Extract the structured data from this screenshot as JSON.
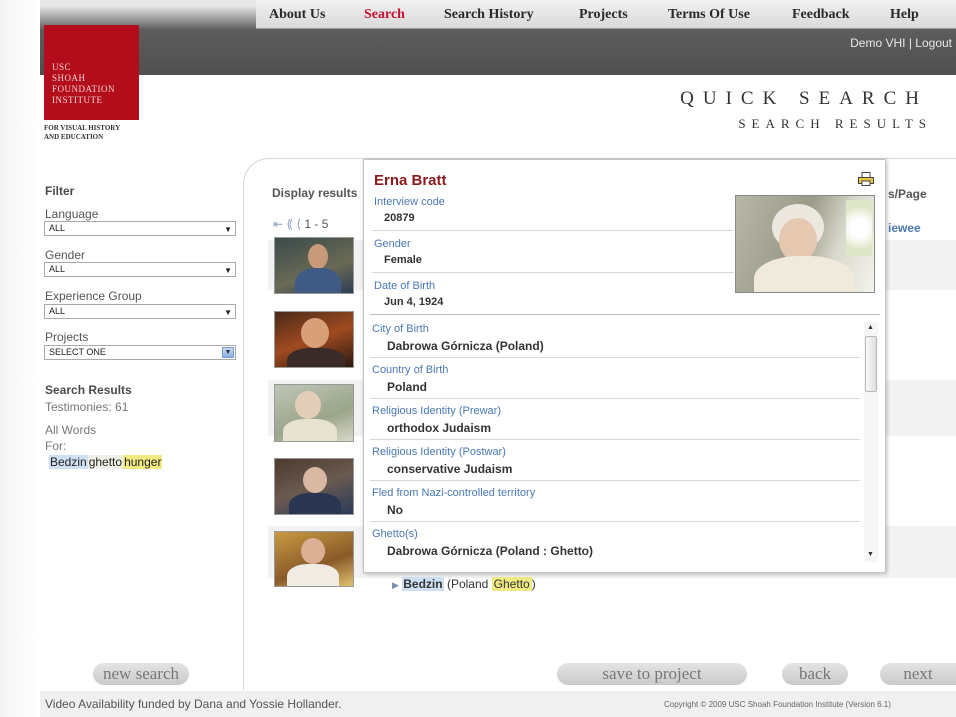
{
  "nav": {
    "items": [
      "About Us",
      "Search",
      "Search History",
      "Projects",
      "Terms Of Use",
      "Feedback",
      "Help"
    ],
    "active": "Search"
  },
  "account": {
    "demo": "Demo VHI",
    "separator": "|",
    "logout": "Logout"
  },
  "logo": {
    "lines": [
      "USC",
      "SHOAH",
      "FOUNDATION",
      "INSTITUTE"
    ],
    "subtitle_lines": [
      "FOR VISUAL HISTORY",
      "AND EDUCATION"
    ]
  },
  "page": {
    "title": "QUICK SEARCH",
    "subtitle": "SEARCH RESULTS"
  },
  "filter": {
    "heading": "Filter",
    "language_label": "Language",
    "language_value": "ALL",
    "gender_label": "Gender",
    "gender_value": "ALL",
    "experience_label": "Experience Group",
    "experience_value": "ALL",
    "projects_label": "Projects",
    "projects_value": "SELECT ONE"
  },
  "results_summary": {
    "heading": "Search Results",
    "testimonies": "Testimonies: 61",
    "all_words": "All Words",
    "for": "For:",
    "terms": [
      "Bedzin",
      "ghetto",
      "hunger"
    ]
  },
  "results": {
    "display_label": "Display results",
    "pager_icons": "⇤ ⟪ ⟨",
    "range": "1 - 5",
    "per_page": "s/Page",
    "col_interviewee": "iewee",
    "bedzin_entry": {
      "name": "Bedzin",
      "paren_open": "(Poland",
      "ghetto": "Ghetto",
      "paren_close": ")"
    }
  },
  "popup": {
    "name": "Erna Bratt",
    "fields": [
      {
        "label": "Interview code",
        "value": "20879"
      },
      {
        "label": "Gender",
        "value": "Female"
      },
      {
        "label": "Date of Birth",
        "value": "Jun 4, 1924"
      }
    ],
    "scroll_fields": [
      {
        "label": "City of Birth",
        "value": "Dabrowa Górnicza (Poland)"
      },
      {
        "label": "Country of Birth",
        "value": "Poland"
      },
      {
        "label": "Religious Identity (Prewar)",
        "value": "orthodox Judaism"
      },
      {
        "label": "Religious Identity (Postwar)",
        "value": "conservative Judaism"
      },
      {
        "label": "Fled from Nazi-controlled territory",
        "value": "No"
      },
      {
        "label": "Ghetto(s)",
        "value": "Dabrowa Górnicza (Poland : Ghetto)"
      }
    ]
  },
  "footer": {
    "new_search": "new search",
    "save_to_project": "save to project",
    "back": "back",
    "next": "next",
    "funding": "Video Availability funded by Dana and Yossie Hollander.",
    "copyright": "Copyright © 2009 USC Shoah Foundation Institute (Version 6.1)"
  },
  "colors": {
    "accent_red": "#c8102e",
    "logo_red": "#b30d1b",
    "name_red": "#8b1a1a",
    "label_blue": "#4a78b5",
    "highlight_yellow": "#f0ea80",
    "highlight_blue": "#cfe0f5"
  }
}
